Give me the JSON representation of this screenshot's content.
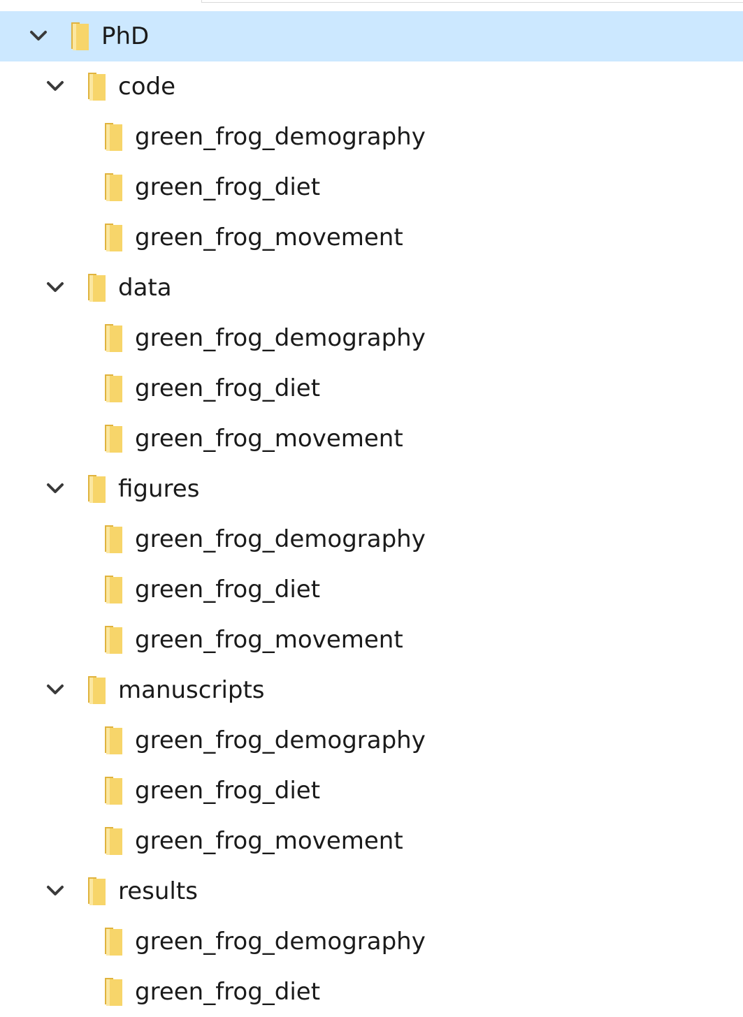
{
  "tree": {
    "root": {
      "label": "PhD",
      "expanded": true,
      "selected": true,
      "icon": "folder-icon"
    },
    "groups": [
      {
        "label": "code",
        "expanded": true,
        "children": [
          "green_frog_demography",
          "green_frog_diet",
          "green_frog_movement"
        ]
      },
      {
        "label": "data",
        "expanded": true,
        "children": [
          "green_frog_demography",
          "green_frog_diet",
          "green_frog_movement"
        ]
      },
      {
        "label": "figures",
        "expanded": true,
        "children": [
          "green_frog_demography",
          "green_frog_diet",
          "green_frog_movement"
        ]
      },
      {
        "label": "manuscripts",
        "expanded": true,
        "children": [
          "green_frog_demography",
          "green_frog_diet",
          "green_frog_movement"
        ]
      },
      {
        "label": "results",
        "expanded": true,
        "children": [
          "green_frog_demography",
          "green_frog_diet"
        ]
      }
    ]
  },
  "colors": {
    "selection": "#cce8ff",
    "folder_main": "#f7d56a",
    "folder_light": "#fbe7a1",
    "folder_dark": "#e0b33e",
    "chevron": "#3a3a3a"
  }
}
